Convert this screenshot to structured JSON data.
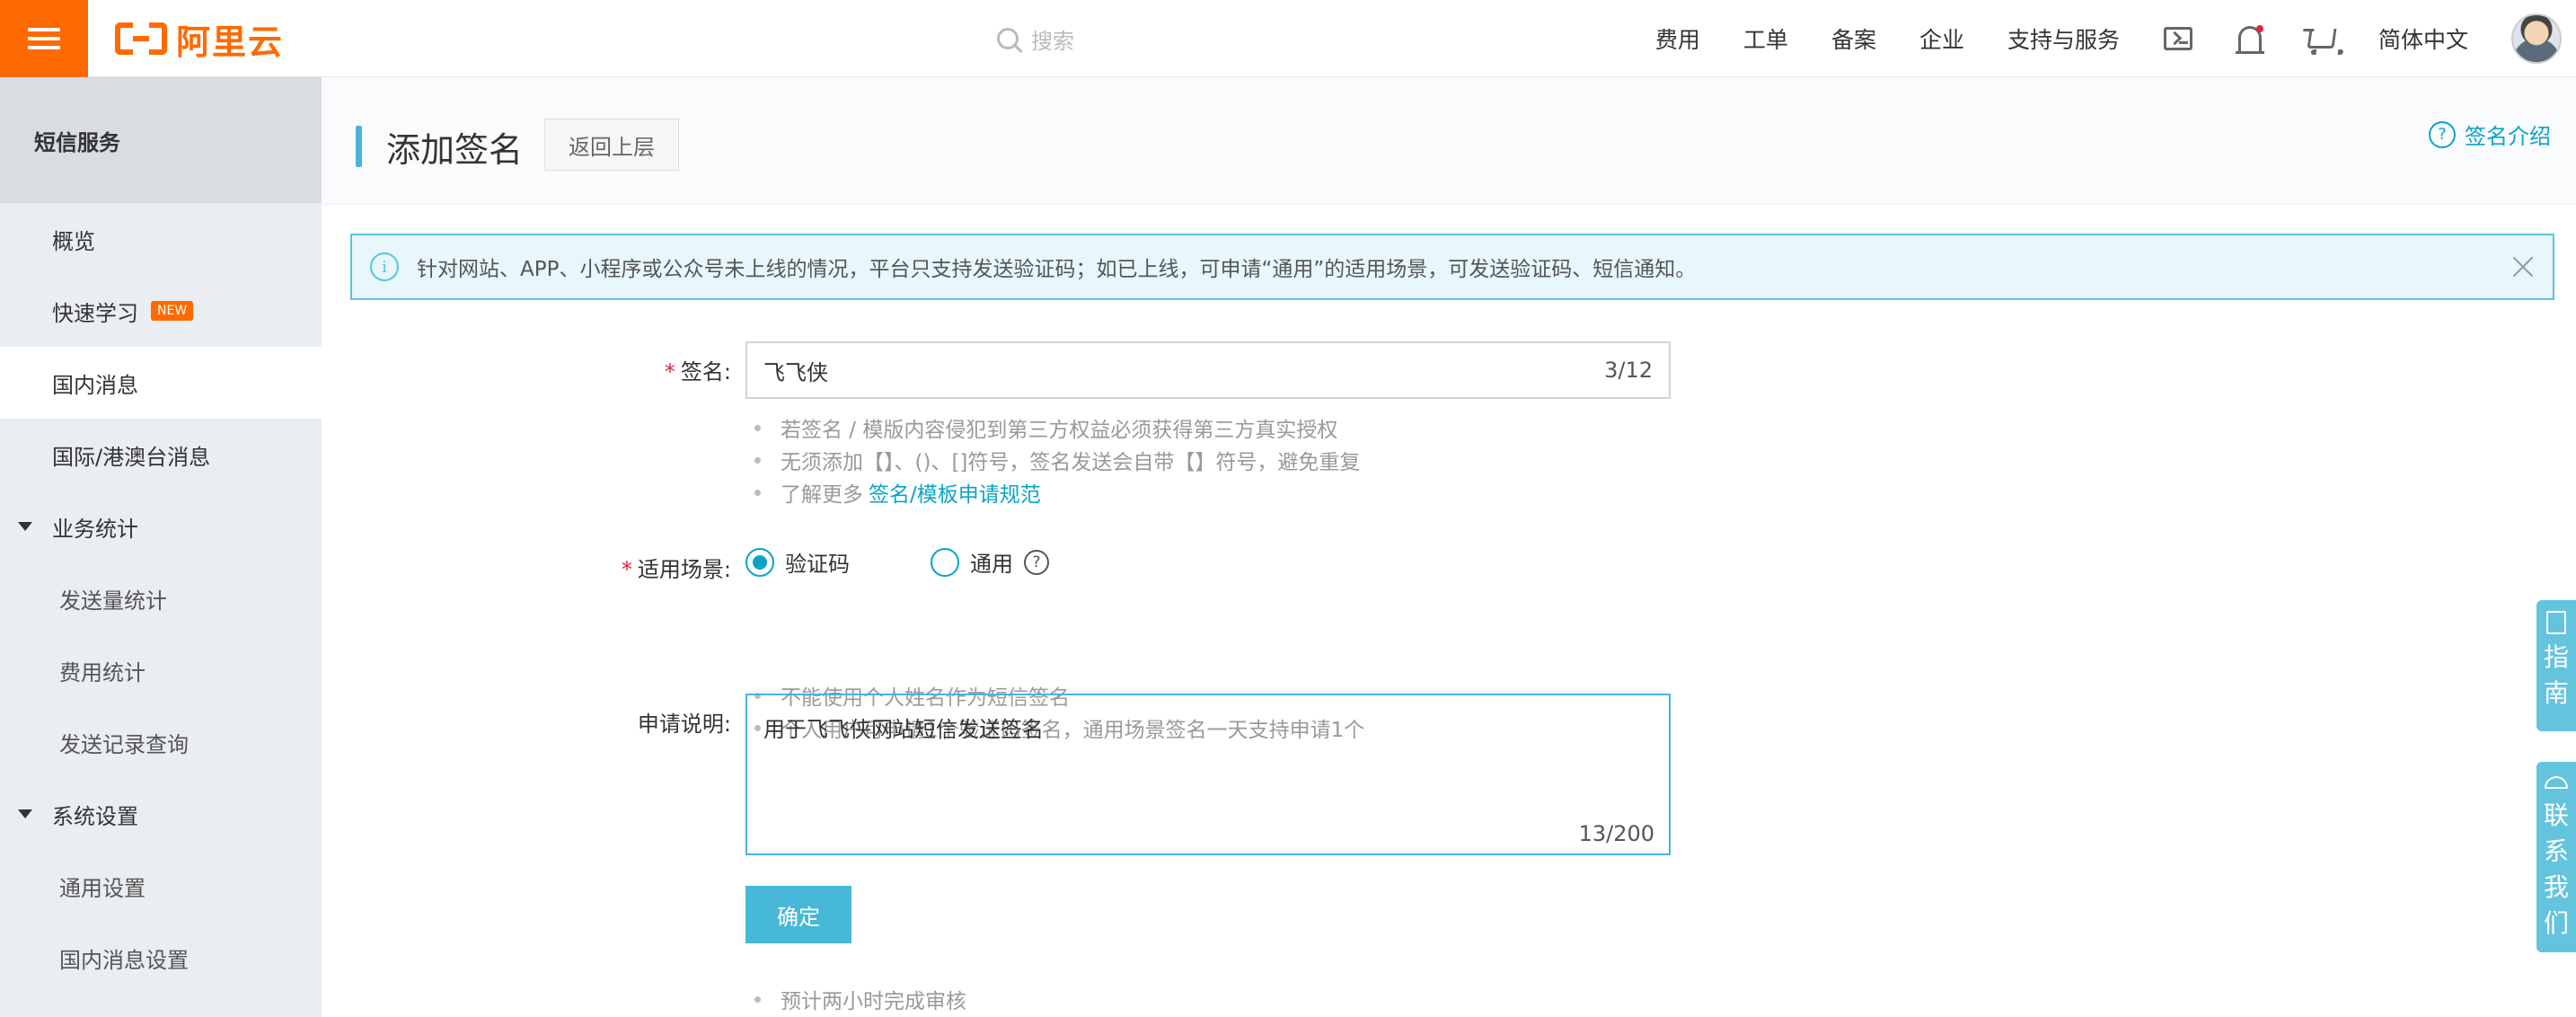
{
  "header": {
    "logo_text": "阿里云",
    "search_placeholder": "搜索",
    "nav": [
      "费用",
      "工单",
      "备案",
      "企业",
      "支持与服务"
    ],
    "language": "简体中文",
    "icons": [
      "menu-icon",
      "search-icon",
      "terminal-icon",
      "bell-icon",
      "cart-icon",
      "avatar"
    ],
    "accent_color": "#ff6a00"
  },
  "sidebar": {
    "title": "短信服务",
    "items": [
      {
        "label": "概览"
      },
      {
        "label": "快速学习",
        "badge": "NEW"
      },
      {
        "label": "国内消息",
        "active": true
      },
      {
        "label": "国际/港澳台消息"
      }
    ],
    "groups": [
      {
        "label": "业务统计",
        "items": [
          "发送量统计",
          "费用统计",
          "发送记录查询"
        ]
      },
      {
        "label": "系统设置",
        "items": [
          "通用设置",
          "国内消息设置"
        ]
      }
    ]
  },
  "page": {
    "title": "添加签名",
    "back_label": "返回上层",
    "intro_link": "签名介绍",
    "alert": "针对网站、APP、小程序或公众号未上线的情况，平台只支持发送验证码；如已上线，可申请“通用”的适用场景，可发送验证码、短信通知。"
  },
  "form": {
    "signature": {
      "label": "签名:",
      "value": "飞飞侠",
      "count": "3/12",
      "hints": [
        "若签名 / 模版内容侵犯到第三方权益必须获得第三方真实授权",
        "无须添加【】、()、[]符号，签名发送会自带【】符号，避免重复",
        "了解更多"
      ],
      "hint_link": "签名/模板申请规范"
    },
    "scene": {
      "label": "适用场景:",
      "options": [
        "验证码",
        "通用"
      ],
      "selected": "验证码",
      "help": "?",
      "hints": [
        "不能使用个人姓名作为短信签名",
        "个人用户可申请1个验证码签名，通用场景签名一天支持申请1个"
      ]
    },
    "description": {
      "label": "申请说明:",
      "value": "用于飞飞侠网站短信发送签名",
      "count": "13/200"
    },
    "submit_label": "确定",
    "footer_hint": "预计两小时完成审核"
  },
  "float_tabs": {
    "guide": [
      "指",
      "南"
    ],
    "contact": [
      "联",
      "系",
      "我",
      "们"
    ],
    "color": "#64c4de"
  },
  "colors": {
    "primary": "#0aa4c8",
    "button": "#48b8d8",
    "required": "#e5243b",
    "alert_bg": "#e7f7fb"
  }
}
